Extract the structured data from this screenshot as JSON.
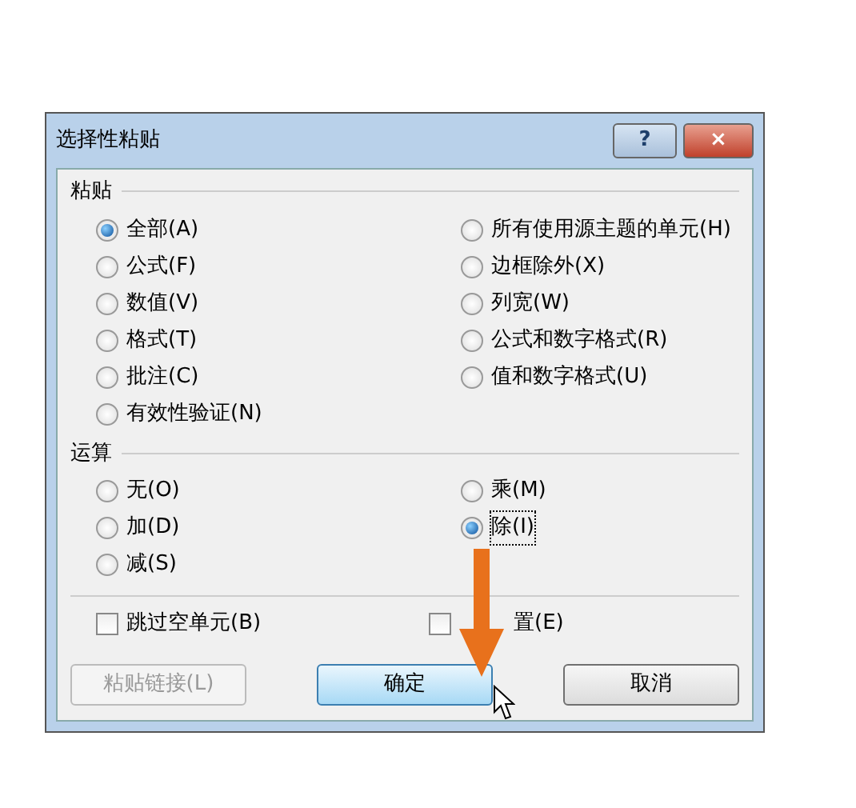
{
  "window": {
    "title": "选择性粘贴",
    "buttons": [
      "?",
      "×"
    ]
  },
  "paste": {
    "title": "粘贴",
    "options": [
      {
        "label": "全部(A)",
        "selected": true
      },
      {
        "label": "所有使用源主题的单元(H)",
        "selected": false
      },
      {
        "label": "公式(F)",
        "selected": false
      },
      {
        "label": "边框除外(X)",
        "selected": false
      },
      {
        "label": "数值(V)",
        "selected": false
      },
      {
        "label": "列宽(W)",
        "selected": false
      },
      {
        "label": "格式(T)",
        "selected": false
      },
      {
        "label": "公式和数字格式(R)",
        "selected": false
      },
      {
        "label": "批注(C)",
        "selected": false
      },
      {
        "label": "值和数字格式(U)",
        "selected": false
      },
      {
        "label": "有效性验证(N)",
        "selected": false
      }
    ]
  },
  "operation": {
    "title": "运算",
    "options": [
      {
        "label": "无(O)",
        "selected": false,
        "focused": false
      },
      {
        "label": "乘(M)",
        "selected": false,
        "focused": false
      },
      {
        "label": "加(D)",
        "selected": false,
        "focused": false
      },
      {
        "label": "除(I)",
        "selected": true,
        "focused": true
      },
      {
        "label": "减(S)",
        "selected": false,
        "focused": false
      }
    ]
  },
  "checkboxes": [
    {
      "label": "跳过空单元(B)",
      "checked": false
    },
    {
      "label": "置(E)",
      "checked": false
    }
  ],
  "buttons": [
    {
      "label": "粘贴链接(L)",
      "disabled": true,
      "highlighted": false
    },
    {
      "label": "确定",
      "disabled": false,
      "highlighted": true
    },
    {
      "label": "取消",
      "disabled": false,
      "highlighted": false
    }
  ]
}
